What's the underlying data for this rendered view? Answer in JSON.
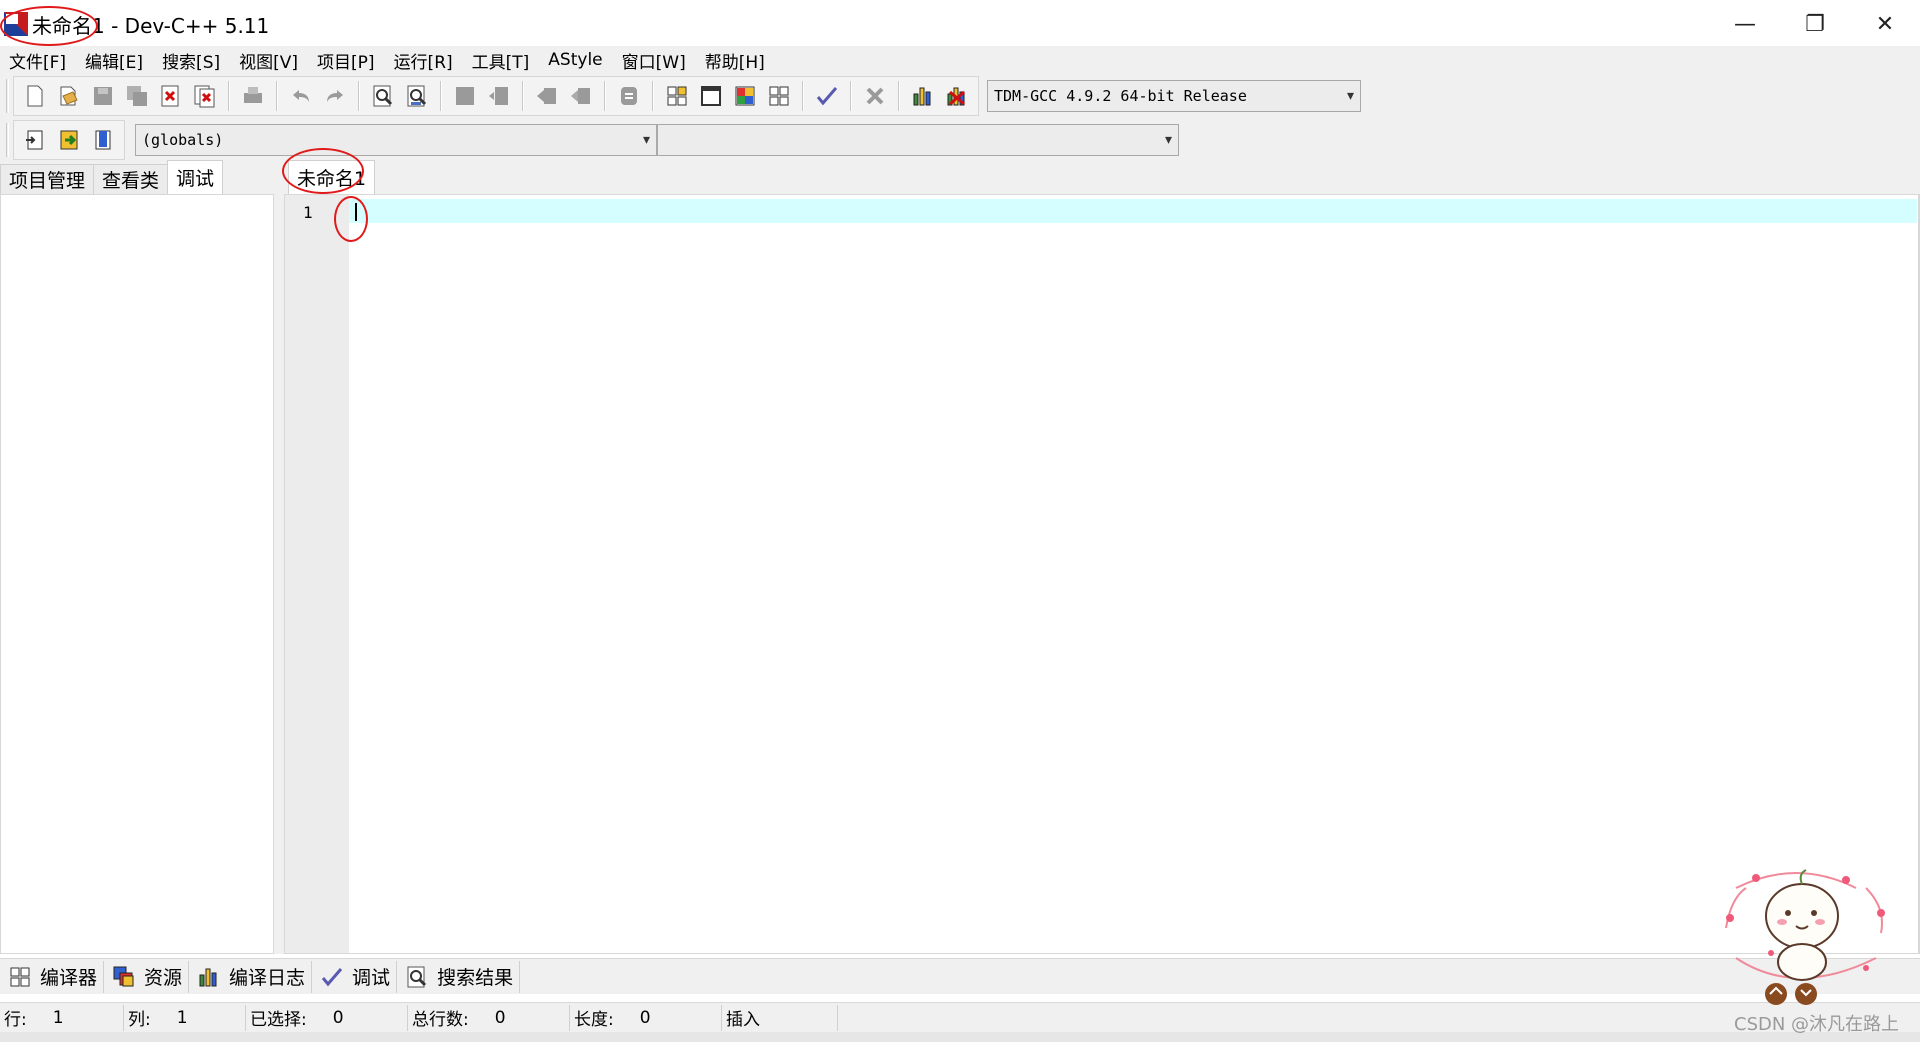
{
  "window": {
    "title_file": "未命名1",
    "title_app": " - Dev-C++ 5.11",
    "controls": {
      "minimize": "—",
      "restore": "❐",
      "close": "✕"
    }
  },
  "menu": [
    "文件[F]",
    "编辑[E]",
    "搜索[S]",
    "视图[V]",
    "项目[P]",
    "运行[R]",
    "工具[T]",
    "AStyle",
    "窗口[W]",
    "帮助[H]"
  ],
  "toolbar": {
    "compiler_selected": "TDM-GCC 4.9.2 64-bit Release",
    "globals_selected": "(globals)",
    "scope_selected": ""
  },
  "left_panel": {
    "tabs": [
      "项目管理",
      "查看类",
      "调试"
    ],
    "active_tab": "调试"
  },
  "editor": {
    "tab_label": "未命名1",
    "line_number": "1",
    "current_line_color": "#d4feff"
  },
  "bottom_tabs": [
    "编译器",
    "资源",
    "编译日志",
    "调试",
    "搜索结果"
  ],
  "status": {
    "row_label": "行:",
    "row_value": "1",
    "col_label": "列:",
    "col_value": "1",
    "sel_label": "已选择:",
    "sel_value": "0",
    "lines_label": "总行数:",
    "lines_value": "0",
    "len_label": "长度:",
    "len_value": "0",
    "mode": "插入"
  },
  "watermark": "CSDN @沐凡在路上",
  "colors": {
    "annotation": "#e01a1a",
    "chrome": "#f0f0f0"
  }
}
